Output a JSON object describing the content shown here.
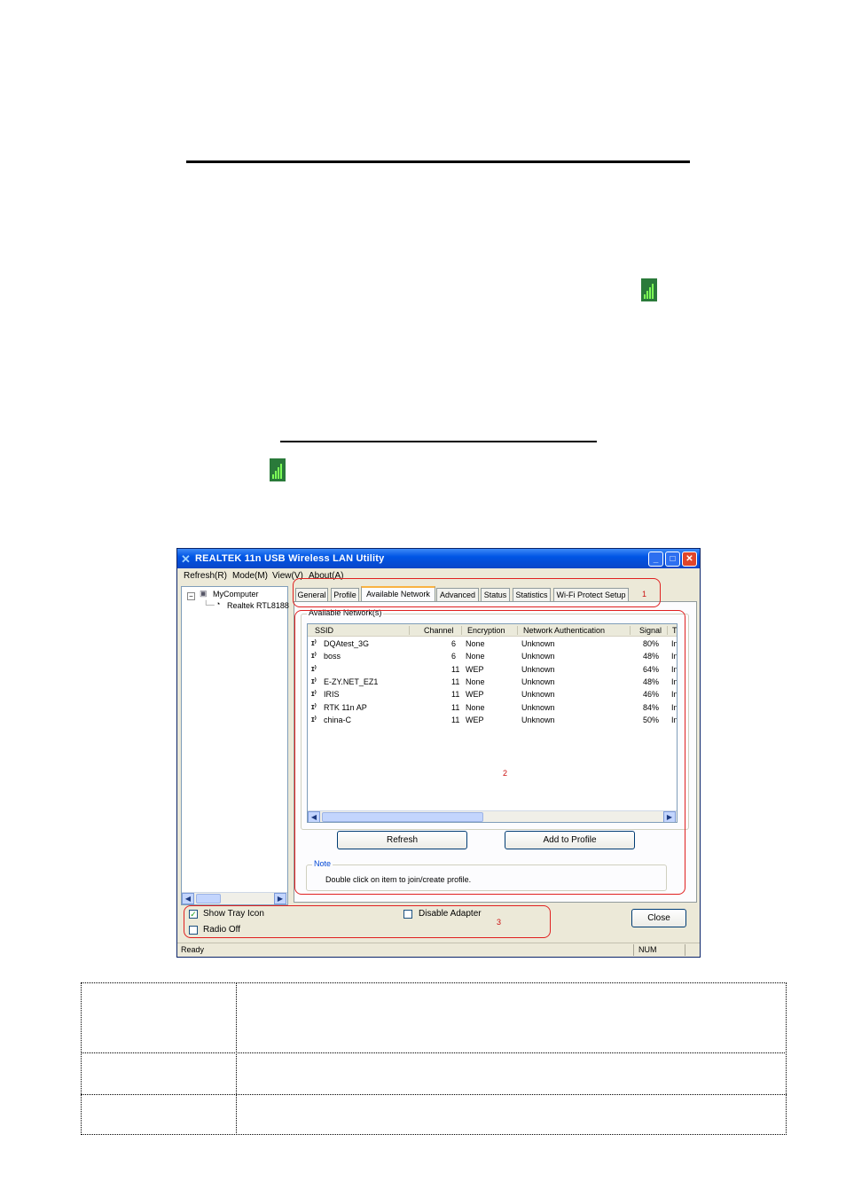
{
  "utility": {
    "title": "REALTEK 11n USB Wireless LAN Utility",
    "menu": [
      "Refresh(R)",
      "Mode(M)",
      "View(V)",
      "About(A)"
    ],
    "tree": {
      "root": "MyComputer",
      "adapter": "Realtek RTL8188"
    },
    "tabs": [
      "General",
      "Profile",
      "Available Network",
      "Advanced",
      "Status",
      "Statistics",
      "Wi-Fi Protect Setup"
    ],
    "active_tab": "Available Network",
    "group_title": "Available Network(s)",
    "columns": [
      "SSID",
      "Channel",
      "Encryption",
      "Network Authentication",
      "Signal",
      "T"
    ],
    "networks": [
      {
        "ssid": "DQAtest_3G",
        "channel": "6",
        "encryption": "None",
        "auth": "Unknown",
        "signal": "80%",
        "type": "In"
      },
      {
        "ssid": "boss",
        "channel": "6",
        "encryption": "None",
        "auth": "Unknown",
        "signal": "48%",
        "type": "In"
      },
      {
        "ssid": "",
        "channel": "11",
        "encryption": "WEP",
        "auth": "Unknown",
        "signal": "64%",
        "type": "In"
      },
      {
        "ssid": "E-ZY.NET_EZ1",
        "channel": "11",
        "encryption": "None",
        "auth": "Unknown",
        "signal": "48%",
        "type": "In"
      },
      {
        "ssid": "IRIS",
        "channel": "11",
        "encryption": "WEP",
        "auth": "Unknown",
        "signal": "46%",
        "type": "In"
      },
      {
        "ssid": "RTK 11n AP",
        "channel": "11",
        "encryption": "None",
        "auth": "Unknown",
        "signal": "84%",
        "type": "In"
      },
      {
        "ssid": "china-C",
        "channel": "11",
        "encryption": "WEP",
        "auth": "Unknown",
        "signal": "50%",
        "type": "In"
      }
    ],
    "buttons": {
      "refresh": "Refresh",
      "add_to_profile": "Add to Profile",
      "close": "Close"
    },
    "note": {
      "title": "Note",
      "text": "Double click on item to join/create profile."
    },
    "options": {
      "show_tray_icon": {
        "label": "Show Tray Icon",
        "checked": true
      },
      "radio_off": {
        "label": "Radio Off",
        "checked": false
      },
      "disable_adapter": {
        "label": "Disable Adapter",
        "checked": false
      }
    },
    "status": {
      "left": "Ready",
      "right": "NUM"
    }
  },
  "annotations": [
    "1",
    "2",
    "3"
  ],
  "colors": {
    "titlebar": "#0055e5",
    "annotation": "#e02020",
    "window_bg": "#ece9d8"
  },
  "icons": [
    "signal-strength-icon",
    "wireless-network-icon",
    "computer-icon"
  ]
}
